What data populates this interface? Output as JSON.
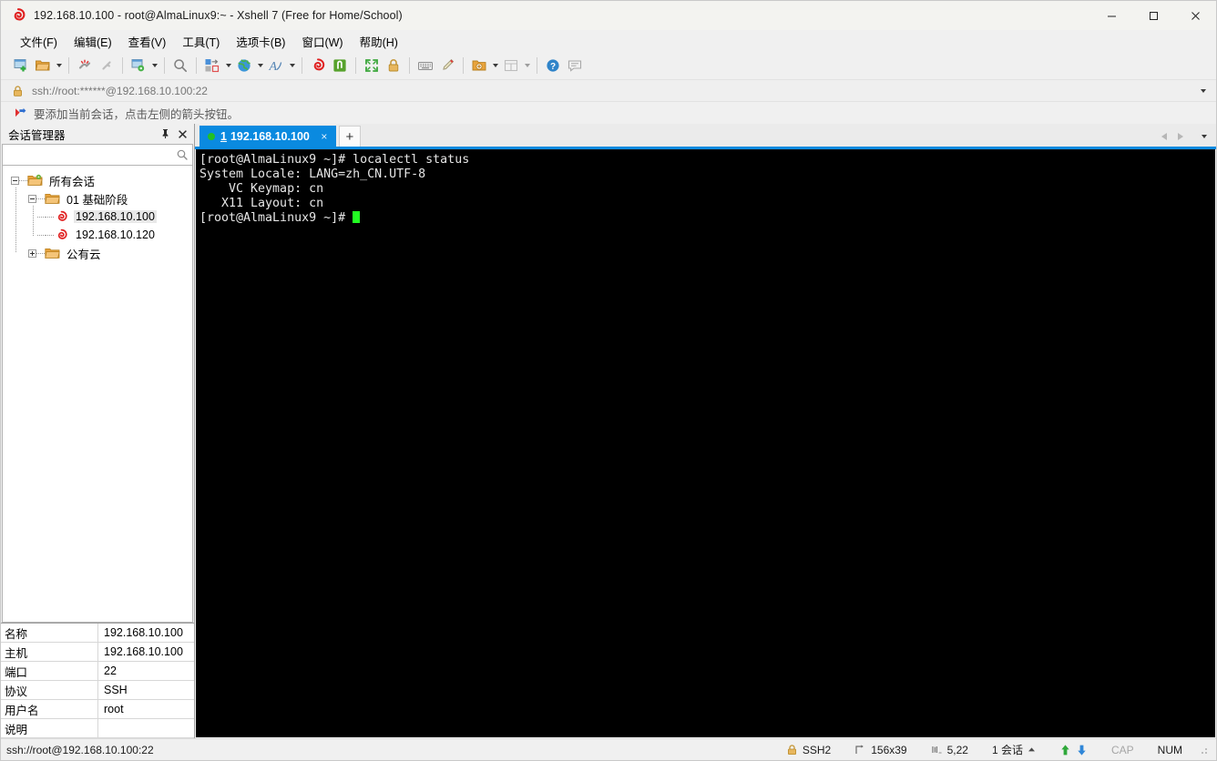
{
  "window": {
    "title": "192.168.10.100 - root@AlmaLinux9:~ - Xshell 7 (Free for Home/School)",
    "icon": "xshell-logo-icon",
    "minimize_label": "—",
    "maximize_label": "□",
    "close_label": "✕"
  },
  "menubar": {
    "items": [
      {
        "label": "文件(F)",
        "name": "menu-file"
      },
      {
        "label": "编辑(E)",
        "name": "menu-edit"
      },
      {
        "label": "查看(V)",
        "name": "menu-view"
      },
      {
        "label": "工具(T)",
        "name": "menu-tools"
      },
      {
        "label": "选项卡(B)",
        "name": "menu-tabs"
      },
      {
        "label": "窗口(W)",
        "name": "menu-window"
      },
      {
        "label": "帮助(H)",
        "name": "menu-help"
      }
    ]
  },
  "toolbar": {
    "icons": [
      "new-session-icon",
      "open-folder-icon",
      "disconnect-icon",
      "connect-icon",
      "session-properties-icon",
      "search-icon",
      "layout-icon",
      "globe-icon",
      "font-icon",
      "xshell-icon",
      "xftp-icon",
      "fullscreen-icon",
      "lock-icon",
      "keyboard-icon",
      "highlight-pen-icon",
      "add-folder-icon",
      "split-view-icon",
      "help-icon",
      "comment-icon"
    ]
  },
  "addressbar": {
    "icon": "lock-icon",
    "value": "ssh://root:******@192.168.10.100:22",
    "dropdown": "chevron-down-icon"
  },
  "notice": {
    "icon": "red-blue-arrow-icon",
    "text": "要添加当前会话，点击左侧的箭头按钮。"
  },
  "sidebar": {
    "title": "会话管理器",
    "pin_icon": "pin-icon",
    "close_icon": "close-icon",
    "search": {
      "value": "",
      "placeholder": "",
      "icon": "search-icon"
    },
    "tree": [
      {
        "label": "所有会话",
        "icon": "folder-all-sessions-icon",
        "expander": "minus",
        "depth": 0,
        "selected": false
      },
      {
        "label": "01 基础阶段",
        "icon": "folder-icon",
        "expander": "minus",
        "depth": 1,
        "selected": false
      },
      {
        "label": "192.168.10.100",
        "icon": "session-icon",
        "expander": "none",
        "depth": 2,
        "selected": true
      },
      {
        "label": "192.168.10.120",
        "icon": "session-icon",
        "expander": "none",
        "depth": 2,
        "selected": false
      },
      {
        "label": "公有云",
        "icon": "folder-icon",
        "expander": "plus",
        "depth": 1,
        "selected": false
      }
    ],
    "properties": [
      {
        "key": "名称",
        "value": "192.168.10.100"
      },
      {
        "key": "主机",
        "value": "192.168.10.100"
      },
      {
        "key": "端口",
        "value": "22"
      },
      {
        "key": "协议",
        "value": "SSH"
      },
      {
        "key": "用户名",
        "value": "root"
      },
      {
        "key": "说明",
        "value": ""
      }
    ]
  },
  "tabs": {
    "items": [
      {
        "number": "1",
        "label": "192.168.10.100",
        "status": "connected",
        "close_label": "×",
        "active": true
      }
    ],
    "new_tab_label": "+",
    "nav_prev": "prev-tab-icon",
    "nav_next": "next-tab-icon",
    "nav_list": "tab-list-icon"
  },
  "terminal": {
    "lines": [
      "[root@AlmaLinux9 ~]# localectl status",
      "System Locale: LANG=zh_CN.UTF-8",
      "    VC Keymap: cn",
      "   X11 Layout: cn",
      "[root@AlmaLinux9 ~]# "
    ],
    "cursor": true
  },
  "statusbar": {
    "connection": "ssh://root@192.168.10.100:22",
    "protocol": {
      "icon": "lock-icon",
      "label": "SSH2"
    },
    "size": {
      "icon": "screen-size-icon",
      "label": "156x39"
    },
    "position": {
      "icon": "cursor-position-icon",
      "label": "5,22"
    },
    "sessions": {
      "label": "1 会话",
      "caret": "caret-up-icon"
    },
    "upload_icon": "upload-arrow-icon",
    "download_icon": "download-arrow-icon",
    "caps": "CAP",
    "num": "NUM"
  },
  "colors": {
    "accent": "#0a8ae0",
    "terminal_bg": "#000000",
    "terminal_fg": "#e6e6e6",
    "cursor": "#22ff22",
    "connected_dot": "#22c024",
    "chrome": "#f0f0f0"
  }
}
